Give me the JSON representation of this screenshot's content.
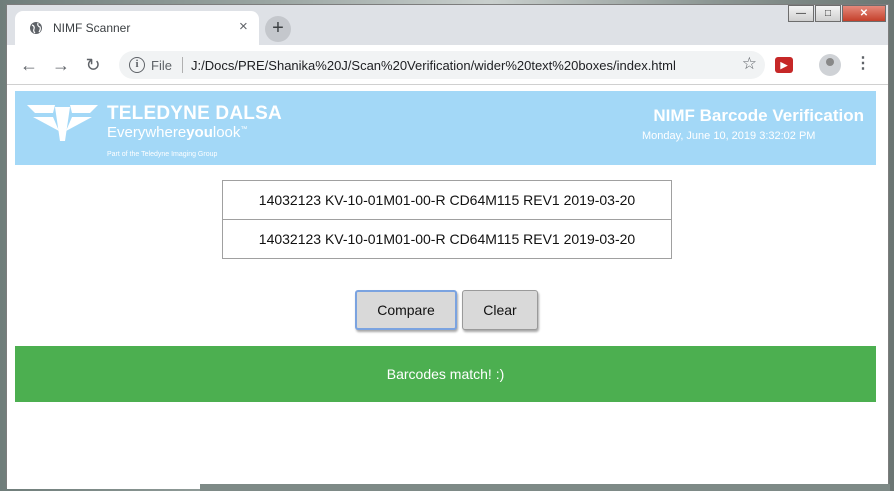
{
  "browser": {
    "tab": {
      "title": "NIMF Scanner",
      "close_glyph": "×",
      "favicon": "globe-icon"
    },
    "new_tab_glyph": "+",
    "window_controls": {
      "minimize": "—",
      "maximize": "□",
      "close": "✕"
    },
    "nav": {
      "back": "←",
      "forward": "→",
      "reload": "↻"
    },
    "omnibox": {
      "info_glyph": "i",
      "scheme_label": "File",
      "url": "J:/Docs/PRE/Shanika%20J/Scan%20Verification/wider%20text%20boxes/index.html",
      "star_glyph": "☆"
    },
    "extension_glyph": "▶",
    "menu_glyph": "⋮"
  },
  "banner": {
    "logo": {
      "brand": "TELEDYNE DALSA",
      "tagline_pre": "Everywhere",
      "tagline_bold": "you",
      "tagline_post": "look",
      "trademark": "™",
      "subline": "Part of the Teledyne Imaging Group"
    },
    "title": "NIMF Barcode Verification",
    "datetime": "Monday, June 10, 2019 3:32:02 PM",
    "background_color": "#a3d8f7"
  },
  "barcodes": {
    "first": "14032123 KV-10-01M01-00-R CD64M115 REV1 2019-03-20",
    "second": "14032123 KV-10-01M01-00-R CD64M115 REV1 2019-03-20"
  },
  "buttons": {
    "compare": "Compare",
    "clear": "Clear"
  },
  "result": {
    "message": "Barcodes match! :)",
    "color": "#4caf50"
  }
}
